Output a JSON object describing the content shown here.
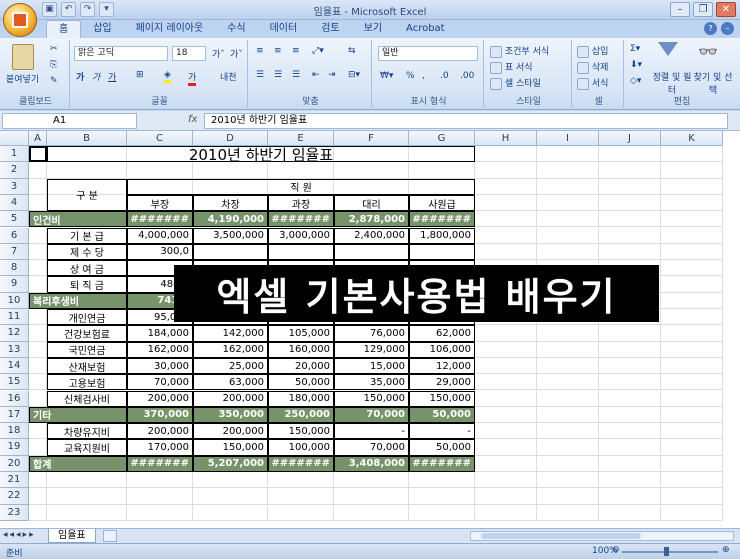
{
  "window": {
    "title": "임율표 - Microsoft Excel"
  },
  "tabs": [
    "홈",
    "삽입",
    "페이지 레이아웃",
    "수식",
    "데이터",
    "검토",
    "보기",
    "Acrobat"
  ],
  "ribbon": {
    "clipboard": {
      "paste": "붙여넣기",
      "label": "클립보드"
    },
    "font": {
      "name": "맑은 고딕",
      "size": "18",
      "label": "글꼴"
    },
    "align": {
      "label": "맞춤"
    },
    "number": {
      "format": "일반",
      "label": "표시 형식"
    },
    "styles": {
      "cond": "조건부 서식",
      "table": "표 서식",
      "cell": "셀 스타일",
      "label": "스타일"
    },
    "cells": {
      "insert": "삽입",
      "delete": "삭제",
      "format": "서식",
      "label": "셀"
    },
    "editing": {
      "sort": "정렬 및 필터",
      "find": "찾기 및 선택",
      "label": "편집"
    }
  },
  "formula_bar": {
    "name_box": "A1",
    "fx": "fx",
    "content": "2010년 하반기 임율표"
  },
  "columns": [
    "A",
    "B",
    "C",
    "D",
    "E",
    "F",
    "G",
    "H",
    "I",
    "J",
    "K"
  ],
  "rows": [
    "1",
    "2",
    "3",
    "4",
    "5",
    "6",
    "7",
    "8",
    "9",
    "10",
    "11",
    "12",
    "13",
    "14",
    "15",
    "16",
    "17",
    "18",
    "19",
    "20",
    "21",
    "22",
    "23"
  ],
  "sheet": {
    "title": "2010년 하반기 임율표",
    "header_category": "구   분",
    "header_staff": "직        원",
    "positions": [
      "부장",
      "차장",
      "과장",
      "대리",
      "사원급"
    ],
    "body": [
      {
        "label": "인건비",
        "group": true,
        "values": [
          "#######",
          "4,190,000",
          "#######",
          "2,878,000",
          "#######"
        ]
      },
      {
        "label": "기 본 급",
        "group": false,
        "values": [
          "4,000,000",
          "3,500,000",
          "3,000,000",
          "2,400,000",
          "1,800,000"
        ]
      },
      {
        "label": "제 수 당",
        "group": false,
        "values": [
          "300,0",
          "",
          "",
          "",
          ""
        ]
      },
      {
        "label": "상 여 금",
        "group": false,
        "values": [
          "",
          "",
          "",
          "",
          ""
        ]
      },
      {
        "label": "퇴 직 금",
        "group": false,
        "values": [
          "480,0",
          "",
          "",
          "",
          ""
        ]
      },
      {
        "label": "복리후생비",
        "group": true,
        "values": [
          "741,0",
          "",
          "",
          "",
          ""
        ]
      },
      {
        "label": "개인연금",
        "group": false,
        "values": [
          "95,000",
          "75,000",
          "65,000",
          "55,000",
          "45,000"
        ]
      },
      {
        "label": "건강보험료",
        "group": false,
        "values": [
          "184,000",
          "142,000",
          "105,000",
          "76,000",
          "62,000"
        ]
      },
      {
        "label": "국민연금",
        "group": false,
        "values": [
          "162,000",
          "162,000",
          "160,000",
          "129,000",
          "106,000"
        ]
      },
      {
        "label": "산재보험",
        "group": false,
        "values": [
          "30,000",
          "25,000",
          "20,000",
          "15,000",
          "12,000"
        ]
      },
      {
        "label": "고용보험",
        "group": false,
        "values": [
          "70,000",
          "63,000",
          "50,000",
          "35,000",
          "29,000"
        ]
      },
      {
        "label": "신체검사비",
        "group": false,
        "values": [
          "200,000",
          "200,000",
          "180,000",
          "150,000",
          "150,000"
        ]
      },
      {
        "label": "기타",
        "group": true,
        "values": [
          "370,000",
          "350,000",
          "250,000",
          "70,000",
          "50,000"
        ]
      },
      {
        "label": "차량유지비",
        "group": false,
        "values": [
          "200,000",
          "200,000",
          "150,000",
          "-",
          "-"
        ]
      },
      {
        "label": "교육지원비",
        "group": false,
        "values": [
          "170,000",
          "150,000",
          "100,000",
          "70,000",
          "50,000"
        ]
      },
      {
        "label": "합계",
        "group": true,
        "values": [
          "#######",
          "5,207,000",
          "#######",
          "3,408,000",
          "#######"
        ]
      }
    ]
  },
  "overlay_text": "엑셀 기본사용법 배우기",
  "sheet_tab": "임율표",
  "status": {
    "ready": "준비",
    "zoom": "100%"
  }
}
